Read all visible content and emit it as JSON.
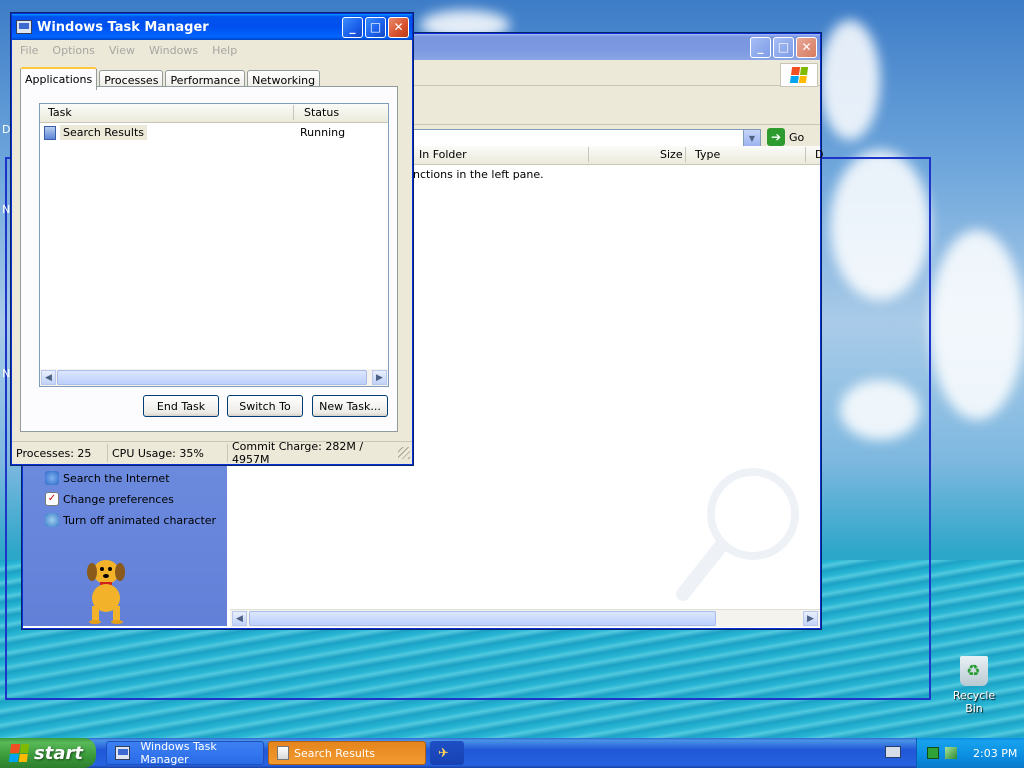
{
  "taskmgr": {
    "title": "Windows Task Manager",
    "menu": [
      "File",
      "Options",
      "View",
      "Windows",
      "Help"
    ],
    "tabs": [
      "Applications",
      "Processes",
      "Performance",
      "Networking"
    ],
    "columns": {
      "task": "Task",
      "status": "Status"
    },
    "rows": [
      {
        "task": "Search Results",
        "status": "Running"
      }
    ],
    "buttons": {
      "end_task": "End Task",
      "switch_to": "Switch To",
      "new_task": "New Task..."
    },
    "status": {
      "processes": "Processes: 25",
      "cpu": "CPU Usage: 35%",
      "commit": "Commit Charge: 282M / 4957M"
    }
  },
  "search": {
    "go_label": "Go",
    "columns": {
      "in_folder": "In Folder",
      "size": "Size",
      "type": "Type",
      "date": "D"
    },
    "results_text": "nctions in the left pane.",
    "companion": {
      "items": [
        "Search the Internet",
        "Change preferences",
        "Turn off animated character"
      ]
    }
  },
  "desktop": {
    "recycle_bin": "Recycle Bin",
    "left_edge_letters": [
      "D",
      "N",
      "N"
    ]
  },
  "taskbar": {
    "start": "start",
    "tasks": [
      "Windows Task Manager",
      "Search Results"
    ],
    "clock": "2:03 PM"
  },
  "colors": {
    "xp_blue": "#0053ee",
    "start_green": "#3a9a3a",
    "active_task_orange": "#f39a2f"
  }
}
